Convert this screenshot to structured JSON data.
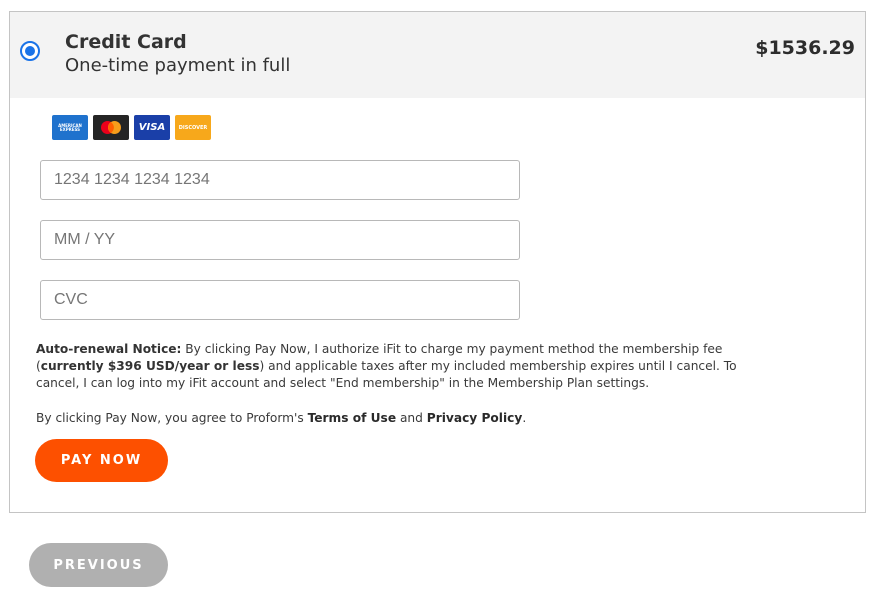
{
  "payment_option": {
    "title": "Credit Card",
    "subtitle": "One-time payment in full",
    "price": "$1536.29"
  },
  "card_brands": [
    {
      "icon": "amex-icon",
      "label": "AMERICAN EXPRESS",
      "color": "#1f72cd"
    },
    {
      "icon": "mastercard-icon",
      "color": "#252525"
    },
    {
      "icon": "visa-icon",
      "label": "VISA",
      "color": "#1a3fa8"
    },
    {
      "icon": "discover-icon",
      "label": "DISCOVER",
      "color": "#f7a81b"
    }
  ],
  "form": {
    "card_number_placeholder": "1234 1234 1234 1234",
    "expiry_placeholder": "MM / YY",
    "cvc_placeholder": "CVC"
  },
  "notice": {
    "label": "Auto-renewal Notice:",
    "text_1": " By clicking Pay Now, I authorize iFit to charge my payment method the membership fee (",
    "fee": "currently $396 USD/year or less",
    "text_2": ") and applicable taxes after my included membership expires until I cancel. To cancel, I can log into my iFit account and select \"End membership\" in the Membership Plan settings."
  },
  "agreement": {
    "prefix": "By clicking Pay Now, you agree to Proform's ",
    "terms_link": "Terms of Use",
    "and": " and ",
    "privacy_link": "Privacy Policy",
    "suffix": "."
  },
  "buttons": {
    "pay": "PAY NOW",
    "previous": "PREVIOUS"
  },
  "colors": {
    "accent": "#fd5000",
    "radio": "#1a73e8",
    "disabled": "#b0b0b0"
  }
}
